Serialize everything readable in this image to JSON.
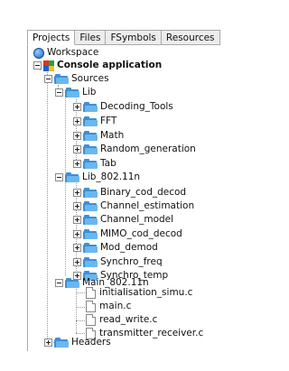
{
  "tabs": [
    "Projects",
    "Files",
    "FSymbols",
    "Resources"
  ],
  "tree": {
    "workspace": "Workspace",
    "project": "Console application",
    "sources": "Sources",
    "lib": "Lib",
    "lib_children": [
      "Decoding_Tools",
      "FFT",
      "Math",
      "Random_generation",
      "Tab"
    ],
    "lib802": "Lib_802.11n",
    "lib802_children": [
      "Binary_cod_decod",
      "Channel_estimation",
      "Channel_model",
      "MIMO_cod_decod",
      "Mod_demod",
      "Synchro_freq",
      "Synchro_temp"
    ],
    "main802": "Main_802.11n",
    "main802_files": [
      "initialisation_simu.c",
      "main.c",
      "read_write.c",
      "transmitter_receiver.c"
    ],
    "headers": "Headers"
  }
}
